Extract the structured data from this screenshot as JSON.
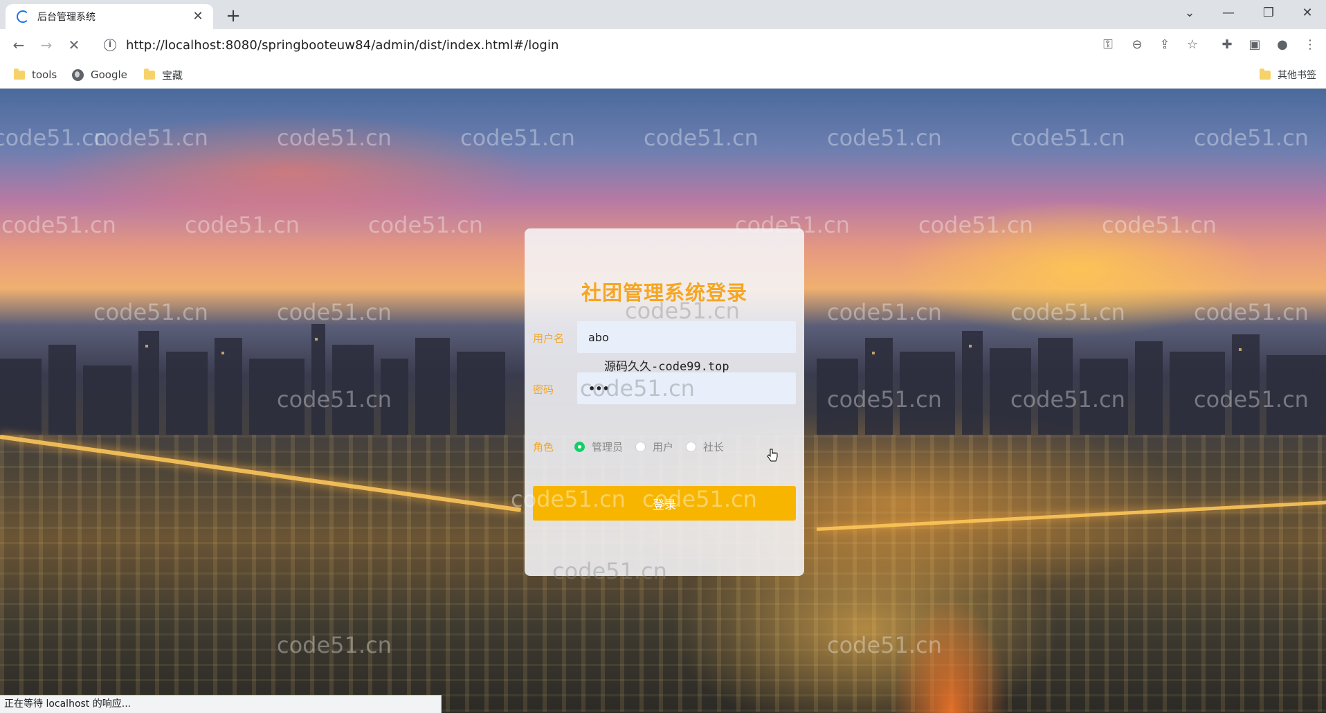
{
  "browser": {
    "tab_title": "后台管理系统",
    "tab_close": "✕",
    "new_tab": "+",
    "url": "http://localhost:8080/springbooteuw84/admin/dist/index.html#/login",
    "bookmarks": [
      "tools",
      "Google",
      "宝藏"
    ],
    "other_bookmarks": "其他书签",
    "status_text": "正在等待 localhost 的响应..."
  },
  "icons": {
    "back": "←",
    "forward": "→",
    "stop": "✕",
    "info": "i",
    "key": "⚿",
    "zoom": "⊖",
    "share": "⇪",
    "star": "☆",
    "extension": "✚",
    "sidebar": "▣",
    "profile": "●",
    "menu": "⋮",
    "chevron": "⌄",
    "minimize": "—",
    "restore": "❐",
    "close": "✕"
  },
  "login": {
    "title": "社团管理系统登录",
    "username_label": "用户名",
    "username_value": "abo",
    "overlay_text": "源码久久-code99.top",
    "password_label": "密码",
    "password_value": "•••",
    "role_label": "角色",
    "roles": [
      "管理员",
      "用户",
      "社长"
    ],
    "selected_role": "管理员",
    "login_button": "登录"
  },
  "watermark": "code51.cn",
  "colors": {
    "accent": "#f5a623",
    "button": "#f7b500",
    "radio_checked": "#13ce66"
  }
}
